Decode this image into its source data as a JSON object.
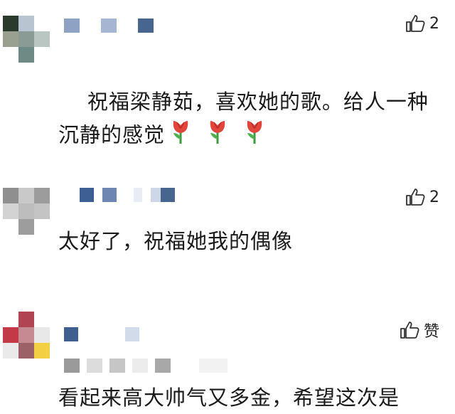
{
  "comments": [
    {
      "text": "祝福梁静茹，喜欢她的歌。给人一种\n沉静的感觉",
      "emoji": [
        "tulip-emoji",
        "tulip-emoji",
        "tulip-emoji"
      ],
      "like_count": "2"
    },
    {
      "text": "太好了，祝福她我的偶像",
      "like_count": "2"
    },
    {
      "text": "看起来高大帅气又多金，希望这次是",
      "like_label": "赞"
    }
  ],
  "colors": {
    "name_blur": "#7f97bd",
    "name_blur_dark": "#3f5f8e",
    "text": "#1a1a1a"
  }
}
